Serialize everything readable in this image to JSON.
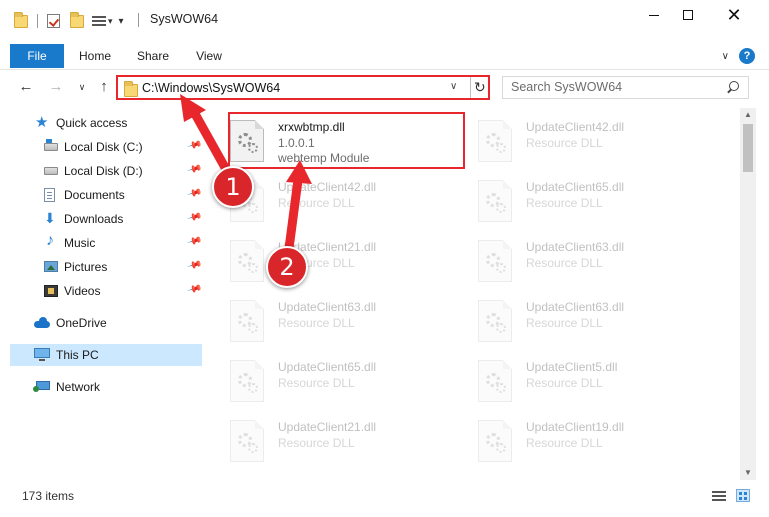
{
  "window": {
    "title": "SysWOW64",
    "minimize": "—",
    "close": "✕"
  },
  "ribbon": {
    "tabs": [
      {
        "label": "File"
      },
      {
        "label": "Home"
      },
      {
        "label": "Share"
      },
      {
        "label": "View"
      }
    ],
    "collapse": "∨",
    "help": "?"
  },
  "address": {
    "back": "←",
    "forward": "→",
    "recent": "∨",
    "up": "↑",
    "path": "C:\\Windows\\SysWOW64",
    "dropdown": "∨",
    "refresh": "↻",
    "search_placeholder": "Search SysWOW64"
  },
  "sidebar": {
    "items": [
      {
        "label": "Quick access",
        "icon": "star-icon",
        "pinned": false
      },
      {
        "label": "Local Disk (C:)",
        "icon": "disk-icon",
        "pinned": true
      },
      {
        "label": "Local Disk (D:)",
        "icon": "disk-icon",
        "pinned": true
      },
      {
        "label": "Documents",
        "icon": "documents-icon",
        "pinned": true
      },
      {
        "label": "Downloads",
        "icon": "downloads-icon",
        "pinned": true
      },
      {
        "label": "Music",
        "icon": "music-icon",
        "pinned": true
      },
      {
        "label": "Pictures",
        "icon": "pictures-icon",
        "pinned": true
      },
      {
        "label": "Videos",
        "icon": "videos-icon",
        "pinned": true
      },
      {
        "label": "OneDrive",
        "icon": "cloud-icon",
        "pinned": false
      },
      {
        "label": "This PC",
        "icon": "pc-icon",
        "pinned": false,
        "selected": true
      },
      {
        "label": "Network",
        "icon": "network-icon",
        "pinned": false
      }
    ],
    "pin_glyph": "📌"
  },
  "files": [
    {
      "name": "xrxwbtmp.dll",
      "line2": "1.0.0.1",
      "line3": "webtemp Module",
      "highlighted": true
    },
    {
      "name": "UpdateClient42.dll",
      "line2": "Resource DLL",
      "line3": ""
    },
    {
      "name": "UpdateClient42.dll",
      "line2": "Resource DLL",
      "line3": ""
    },
    {
      "name": "UpdateClient65.dll",
      "line2": "Resource DLL",
      "line3": ""
    },
    {
      "name": "UpdateClient21.dll",
      "line2": "Resource DLL",
      "line3": ""
    },
    {
      "name": "UpdateClient63.dll",
      "line2": "Resource DLL",
      "line3": ""
    },
    {
      "name": "UpdateClient63.dll",
      "line2": "Resource DLL",
      "line3": ""
    },
    {
      "name": "UpdateClient63.dll",
      "line2": "Resource DLL",
      "line3": ""
    },
    {
      "name": "UpdateClient65.dll",
      "line2": "Resource DLL",
      "line3": ""
    },
    {
      "name": "UpdateClient5.dll",
      "line2": "Resource DLL",
      "line3": ""
    },
    {
      "name": "UpdateClient21.dll",
      "line2": "Resource DLL",
      "line3": ""
    },
    {
      "name": "UpdateClient19.dll",
      "line2": "Resource DLL",
      "line3": ""
    }
  ],
  "status": {
    "items_count": "173 items"
  },
  "annotations": {
    "step1": "1",
    "step2": "2",
    "color": "#e8272c"
  },
  "colors": {
    "accent": "#1979ca",
    "selection": "#cce8ff",
    "annotation_red": "#e8272c"
  }
}
